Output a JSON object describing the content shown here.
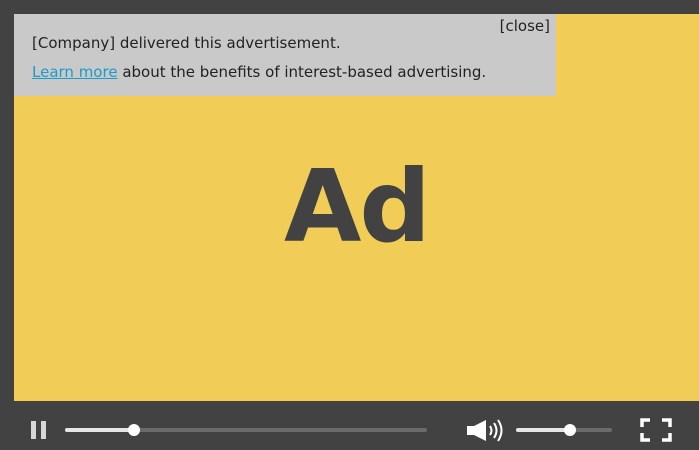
{
  "ad": {
    "text": "Ad",
    "background_color": "#f1cd57",
    "text_color": "#424242"
  },
  "info_box": {
    "line1": "[Company] delivered this advertisement.",
    "learn_more": "Learn more",
    "line2_rest": " about the benefits of interest-based advertising.",
    "close_label": "[close]",
    "link_color": "#1a9ccc"
  },
  "controls": {
    "play_state": "playing",
    "pause_icon": "pause-icon",
    "progress_fraction": 0.19,
    "volume_icon": "volume-icon",
    "volume_fraction": 0.56,
    "fullscreen_icon": "fullscreen-icon",
    "bar_color": "#424242"
  }
}
